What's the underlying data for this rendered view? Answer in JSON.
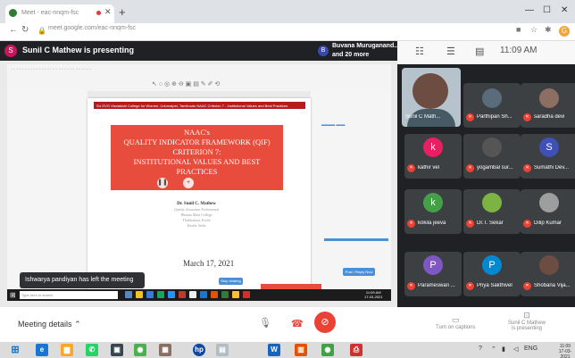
{
  "browser": {
    "tab_title": "Meet - eac-nnqm-fsc",
    "url": "meet.google.com/eac-nnqm-fsc",
    "profile_initial": "G"
  },
  "meet": {
    "presenter_initial": "S",
    "presenter_label": "Sunil C Mathew is presenting",
    "others_initial": "B",
    "others_line1": "Buvana Muruganand...",
    "others_line2": "and 20 more",
    "time": "11:09 AM",
    "toast": "Ishwarya pandiyan has left the meeting",
    "meeting_details": "Meeting details",
    "captions_label": "Turn on captions",
    "present_label_line1": "Sunil C Mathew",
    "present_label_line2": "is presenting"
  },
  "slide": {
    "header_band": "Sri GVG Visalakshi College for Women, Udumalpet, Tamilnadu      NAAC Criterion 7 - Institutional Values and Best Practices",
    "title_lines": [
      "NAAC's",
      "QUALITY INDICATOR FRAMEWORK (QIF)",
      "CRITERION 7:",
      "INSTITUTIONAL VALUES AND BEST",
      "PRACTICES"
    ],
    "author_name": "Dr. Sunil C. Mathew",
    "author_details": [
      "Quality Assurance Professional",
      "Bharata Mata College",
      "Thrikkakara, Kochi",
      "Kerala, India"
    ],
    "date": "March 17, 2021",
    "inner_button": "Stop sharing",
    "right_button": "Post / Reply Now",
    "inner_search_placeholder": "Type here to search",
    "inner_clock_time": "11:09 AM",
    "inner_clock_date": "17-03-2021"
  },
  "participants": [
    {
      "name": "Sunil C Math...",
      "type": "video"
    },
    {
      "name": "Parthipan Sh...",
      "initial": "",
      "color": "#5a6b7c"
    },
    {
      "name": "saradha devi",
      "initial": "",
      "color": "#8d6e63"
    },
    {
      "name": "kathir vel",
      "initial": "k",
      "color": "#e91e63"
    },
    {
      "name": "yogambal sur...",
      "initial": "",
      "color": "#555555"
    },
    {
      "name": "Sumathi Dev...",
      "initial": "S",
      "color": "#3f51b5"
    },
    {
      "name": "kokila jeeva",
      "initial": "k",
      "color": "#43a047"
    },
    {
      "name": "Dr.T. Sekar",
      "initial": "",
      "color": "#7cb342"
    },
    {
      "name": "Dilip Kumar",
      "initial": "",
      "color": "#9e9e9e"
    },
    {
      "name": "Parameswari ...",
      "initial": "P",
      "color": "#7e57c2"
    },
    {
      "name": "Priya Sakthivel",
      "initial": "P",
      "color": "#0288d1"
    },
    {
      "name": "Shobana Vija...",
      "initial": "",
      "color": "#6d4c41"
    }
  ],
  "taskbar": {
    "lang": "ENG",
    "clock_time": "11:09",
    "clock_date": "17-03-2021"
  }
}
